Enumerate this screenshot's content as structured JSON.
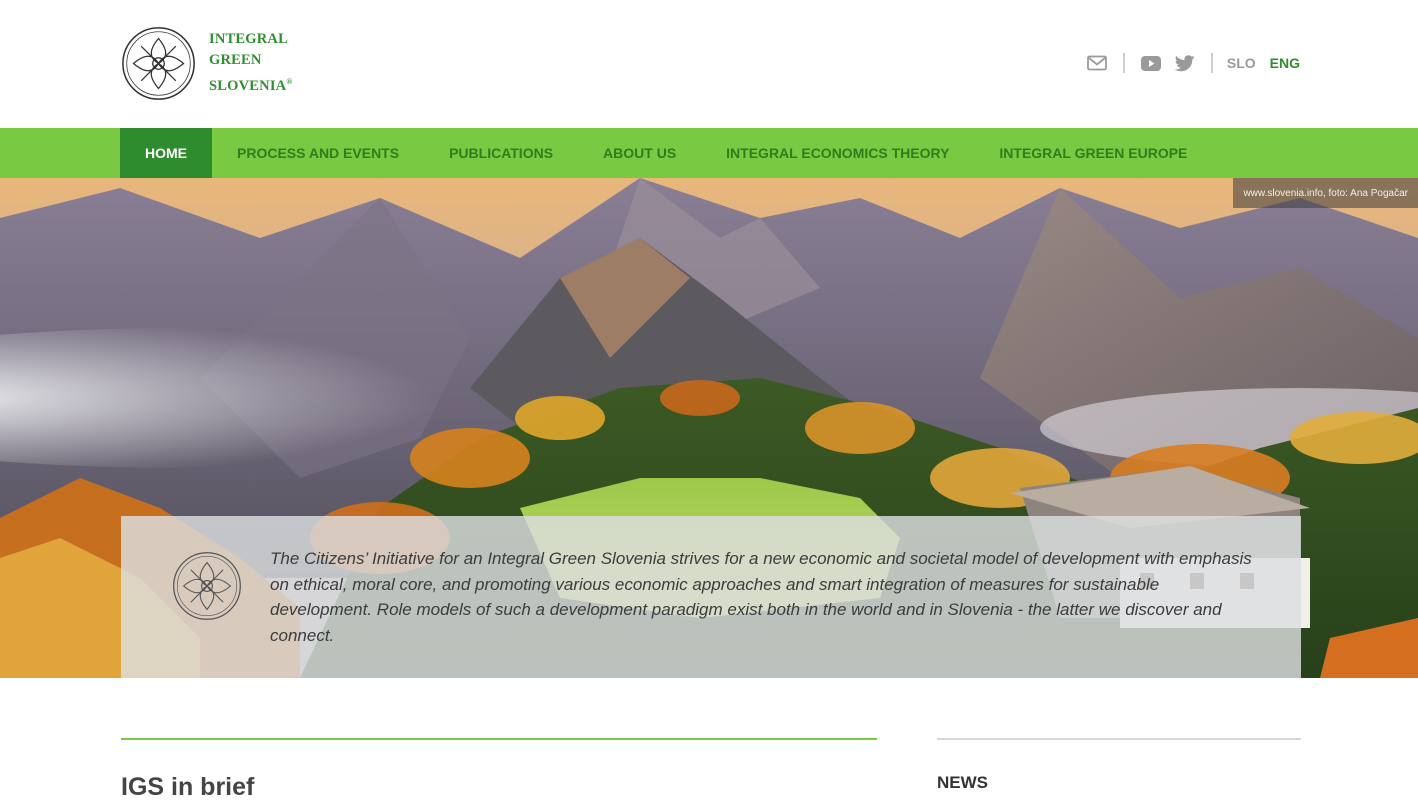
{
  "logo": {
    "line1": "INTEGRAL",
    "line2": "GREEN",
    "line3": "SLOVENIA",
    "reg": "®",
    "color": "#2f8f2f"
  },
  "header": {
    "icons": [
      "mail-icon",
      "youtube-icon",
      "twitter-icon"
    ],
    "languages": [
      "SLO",
      "ENG"
    ],
    "active_language": "ENG"
  },
  "nav": {
    "items": [
      {
        "label": "HOME",
        "active": true
      },
      {
        "label": "PROCESS AND EVENTS"
      },
      {
        "label": "PUBLICATIONS"
      },
      {
        "label": "ABOUT US"
      },
      {
        "label": "INTEGRAL ECONOMICS THEORY"
      },
      {
        "label": "INTEGRAL GREEN EUROPE"
      }
    ],
    "bg_color": "#7ac943",
    "active_color": "#2e8b2e"
  },
  "hero": {
    "photo_credit": "www.slovenia.info, foto: Ana Pogačar",
    "intro_text": "The Citizens’ Initiative for an Integral Green Slovenia strives for a new economic and societal model of development with emphasis on ethical, moral core, and promoting various economic approaches and smart integration of measures for sustainable development. Role models of such a development paradigm exist both in the world and in Slovenia - the latter we discover and connect."
  },
  "content": {
    "left_heading": "IGS in brief",
    "right_heading": "NEWS"
  }
}
